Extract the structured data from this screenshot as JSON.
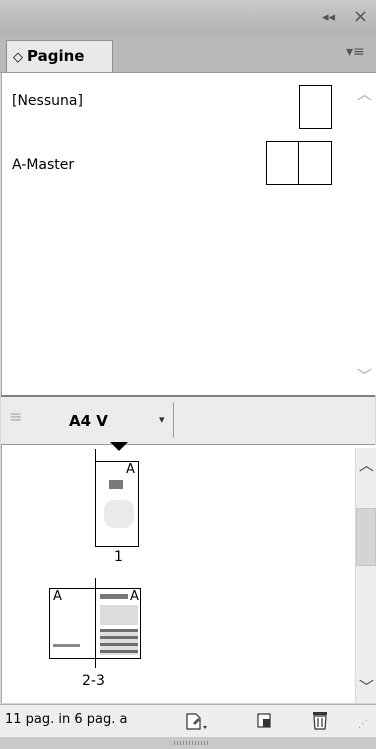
{
  "titlebar": {
    "collapse_icon": "double-chevron-icon",
    "close_glyph": "×"
  },
  "tab": {
    "label": "Pagine",
    "sort_glyph": "◇"
  },
  "masters": [
    {
      "label": "[Nessuna]"
    },
    {
      "label": "A-Master"
    }
  ],
  "master_dropdown": {
    "value": "A4 V"
  },
  "pages": [
    {
      "label": "1",
      "master_prefix": "A"
    },
    {
      "label": "2-3",
      "master_prefix_left": "A",
      "master_prefix_right": "A"
    }
  ],
  "status": {
    "text": "11 pag. in 6 pag. a"
  }
}
